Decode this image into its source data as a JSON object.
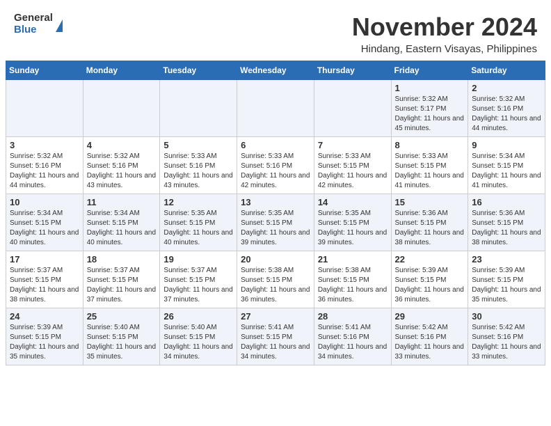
{
  "header": {
    "logo_general": "General",
    "logo_blue": "Blue",
    "month_title": "November 2024",
    "location": "Hindang, Eastern Visayas, Philippines"
  },
  "weekdays": [
    "Sunday",
    "Monday",
    "Tuesday",
    "Wednesday",
    "Thursday",
    "Friday",
    "Saturday"
  ],
  "weeks": [
    [
      {
        "day": "",
        "info": ""
      },
      {
        "day": "",
        "info": ""
      },
      {
        "day": "",
        "info": ""
      },
      {
        "day": "",
        "info": ""
      },
      {
        "day": "",
        "info": ""
      },
      {
        "day": "1",
        "info": "Sunrise: 5:32 AM\nSunset: 5:17 PM\nDaylight: 11 hours and 45 minutes."
      },
      {
        "day": "2",
        "info": "Sunrise: 5:32 AM\nSunset: 5:16 PM\nDaylight: 11 hours and 44 minutes."
      }
    ],
    [
      {
        "day": "3",
        "info": "Sunrise: 5:32 AM\nSunset: 5:16 PM\nDaylight: 11 hours and 44 minutes."
      },
      {
        "day": "4",
        "info": "Sunrise: 5:32 AM\nSunset: 5:16 PM\nDaylight: 11 hours and 43 minutes."
      },
      {
        "day": "5",
        "info": "Sunrise: 5:33 AM\nSunset: 5:16 PM\nDaylight: 11 hours and 43 minutes."
      },
      {
        "day": "6",
        "info": "Sunrise: 5:33 AM\nSunset: 5:16 PM\nDaylight: 11 hours and 42 minutes."
      },
      {
        "day": "7",
        "info": "Sunrise: 5:33 AM\nSunset: 5:15 PM\nDaylight: 11 hours and 42 minutes."
      },
      {
        "day": "8",
        "info": "Sunrise: 5:33 AM\nSunset: 5:15 PM\nDaylight: 11 hours and 41 minutes."
      },
      {
        "day": "9",
        "info": "Sunrise: 5:34 AM\nSunset: 5:15 PM\nDaylight: 11 hours and 41 minutes."
      }
    ],
    [
      {
        "day": "10",
        "info": "Sunrise: 5:34 AM\nSunset: 5:15 PM\nDaylight: 11 hours and 40 minutes."
      },
      {
        "day": "11",
        "info": "Sunrise: 5:34 AM\nSunset: 5:15 PM\nDaylight: 11 hours and 40 minutes."
      },
      {
        "day": "12",
        "info": "Sunrise: 5:35 AM\nSunset: 5:15 PM\nDaylight: 11 hours and 40 minutes."
      },
      {
        "day": "13",
        "info": "Sunrise: 5:35 AM\nSunset: 5:15 PM\nDaylight: 11 hours and 39 minutes."
      },
      {
        "day": "14",
        "info": "Sunrise: 5:35 AM\nSunset: 5:15 PM\nDaylight: 11 hours and 39 minutes."
      },
      {
        "day": "15",
        "info": "Sunrise: 5:36 AM\nSunset: 5:15 PM\nDaylight: 11 hours and 38 minutes."
      },
      {
        "day": "16",
        "info": "Sunrise: 5:36 AM\nSunset: 5:15 PM\nDaylight: 11 hours and 38 minutes."
      }
    ],
    [
      {
        "day": "17",
        "info": "Sunrise: 5:37 AM\nSunset: 5:15 PM\nDaylight: 11 hours and 38 minutes."
      },
      {
        "day": "18",
        "info": "Sunrise: 5:37 AM\nSunset: 5:15 PM\nDaylight: 11 hours and 37 minutes."
      },
      {
        "day": "19",
        "info": "Sunrise: 5:37 AM\nSunset: 5:15 PM\nDaylight: 11 hours and 37 minutes."
      },
      {
        "day": "20",
        "info": "Sunrise: 5:38 AM\nSunset: 5:15 PM\nDaylight: 11 hours and 36 minutes."
      },
      {
        "day": "21",
        "info": "Sunrise: 5:38 AM\nSunset: 5:15 PM\nDaylight: 11 hours and 36 minutes."
      },
      {
        "day": "22",
        "info": "Sunrise: 5:39 AM\nSunset: 5:15 PM\nDaylight: 11 hours and 36 minutes."
      },
      {
        "day": "23",
        "info": "Sunrise: 5:39 AM\nSunset: 5:15 PM\nDaylight: 11 hours and 35 minutes."
      }
    ],
    [
      {
        "day": "24",
        "info": "Sunrise: 5:39 AM\nSunset: 5:15 PM\nDaylight: 11 hours and 35 minutes."
      },
      {
        "day": "25",
        "info": "Sunrise: 5:40 AM\nSunset: 5:15 PM\nDaylight: 11 hours and 35 minutes."
      },
      {
        "day": "26",
        "info": "Sunrise: 5:40 AM\nSunset: 5:15 PM\nDaylight: 11 hours and 34 minutes."
      },
      {
        "day": "27",
        "info": "Sunrise: 5:41 AM\nSunset: 5:15 PM\nDaylight: 11 hours and 34 minutes."
      },
      {
        "day": "28",
        "info": "Sunrise: 5:41 AM\nSunset: 5:16 PM\nDaylight: 11 hours and 34 minutes."
      },
      {
        "day": "29",
        "info": "Sunrise: 5:42 AM\nSunset: 5:16 PM\nDaylight: 11 hours and 33 minutes."
      },
      {
        "day": "30",
        "info": "Sunrise: 5:42 AM\nSunset: 5:16 PM\nDaylight: 11 hours and 33 minutes."
      }
    ]
  ]
}
